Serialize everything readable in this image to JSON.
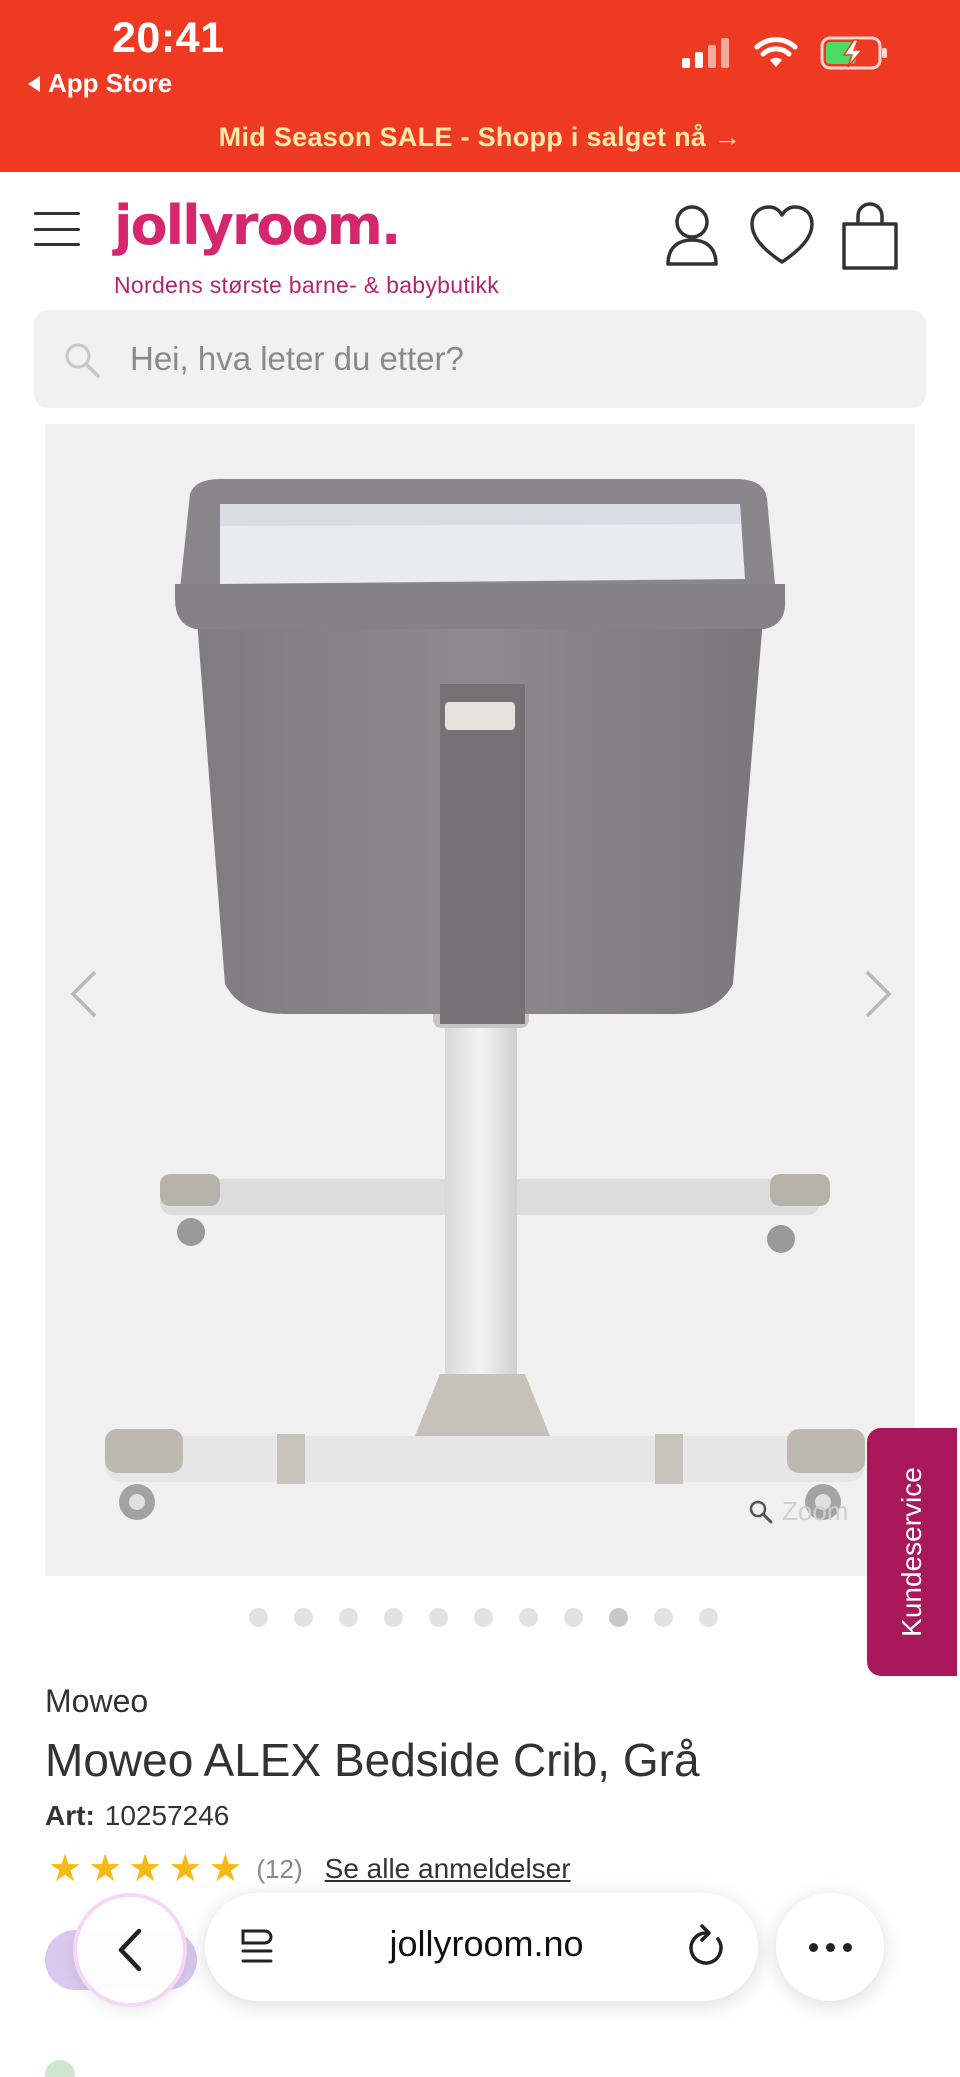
{
  "status_bar": {
    "time": "20:41",
    "back_app": "App Store",
    "icons": [
      "signal-icon",
      "wifi-icon",
      "battery-charging-icon"
    ]
  },
  "promo": {
    "text": "Mid Season SALE - Shopp i salget nå →"
  },
  "header": {
    "logo": "jollyroom.",
    "tagline": "Nordens største barne- & babybutikk",
    "icons": [
      "menu-icon",
      "account-icon",
      "wishlist-icon",
      "cart-icon"
    ]
  },
  "search": {
    "placeholder": "Hei, hva leter du etter?"
  },
  "gallery": {
    "zoom_label": "Zoom",
    "dot_count": 11,
    "active_index": 8
  },
  "customer_service": {
    "label": "Kundeservice"
  },
  "product": {
    "brand": "Moweo",
    "title": "Moweo ALEX Bedside Crib, Grå",
    "art_label": "Art:",
    "art_number": "10257246",
    "rating": 5,
    "review_count": "(12)",
    "reviews_link": "Se alle anmeldelser"
  },
  "browser": {
    "url": "jollyroom.no"
  },
  "colors": {
    "top_bar": "#ee3a23",
    "brand_pink": "#d6266d",
    "customer_service": "#a8185a",
    "star": "#f7b916"
  }
}
